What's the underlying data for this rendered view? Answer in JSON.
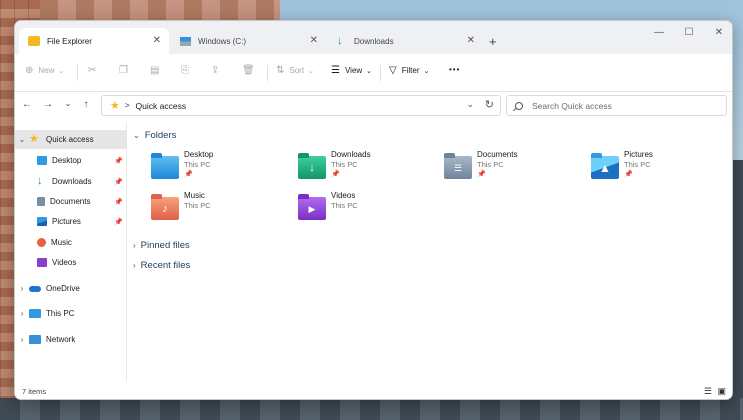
{
  "tabs": [
    {
      "label": "File Explorer",
      "close": "✕"
    },
    {
      "label": "Windows (C:)",
      "close": "✕"
    },
    {
      "label": "Downloads",
      "close": "✕"
    }
  ],
  "new_tab": "+",
  "window_controls": {
    "minimize": "—",
    "maximize": "☐",
    "close": "✕"
  },
  "command_bar": {
    "new_label": "New",
    "sort_label": "Sort",
    "view_label": "View",
    "filter_label": "Filter",
    "more": "•••"
  },
  "nav": {
    "back": "←",
    "forward": "→",
    "history": "⌄",
    "up": "↑"
  },
  "address": {
    "location": "Quick access",
    "chevron": ">",
    "dropdown": "⌄",
    "refresh": "↻"
  },
  "search": {
    "placeholder": "Search Quick access"
  },
  "sidebar": {
    "items": [
      {
        "label": "Quick access",
        "arrow": "⌄"
      },
      {
        "label": "Desktop",
        "pin": "📌"
      },
      {
        "label": "Downloads",
        "pin": "📌"
      },
      {
        "label": "Documents",
        "pin": "📌"
      },
      {
        "label": "Pictures",
        "pin": "📌"
      },
      {
        "label": "Music"
      },
      {
        "label": "Videos"
      },
      {
        "label": "OneDrive",
        "arrow": "›"
      },
      {
        "label": "This PC",
        "arrow": "›"
      },
      {
        "label": "Network",
        "arrow": "›"
      }
    ]
  },
  "main": {
    "folders_header": "Folders",
    "folders": [
      {
        "name": "Desktop",
        "location": "This PC",
        "pinned": "📌"
      },
      {
        "name": "Downloads",
        "location": "This PC",
        "pinned": "📌"
      },
      {
        "name": "Documents",
        "location": "This PC",
        "pinned": "📌"
      },
      {
        "name": "Pictures",
        "location": "This PC",
        "pinned": "📌"
      },
      {
        "name": "Music",
        "location": "This PC"
      },
      {
        "name": "Videos",
        "location": "This PC"
      }
    ],
    "pinned_header": "Pinned files",
    "recent_header": "Recent files"
  },
  "status": {
    "count": "7 items"
  },
  "colors": {
    "accent": "#0067c0",
    "folder_blue": "#2f9ae0",
    "star": "#f3b91d"
  }
}
